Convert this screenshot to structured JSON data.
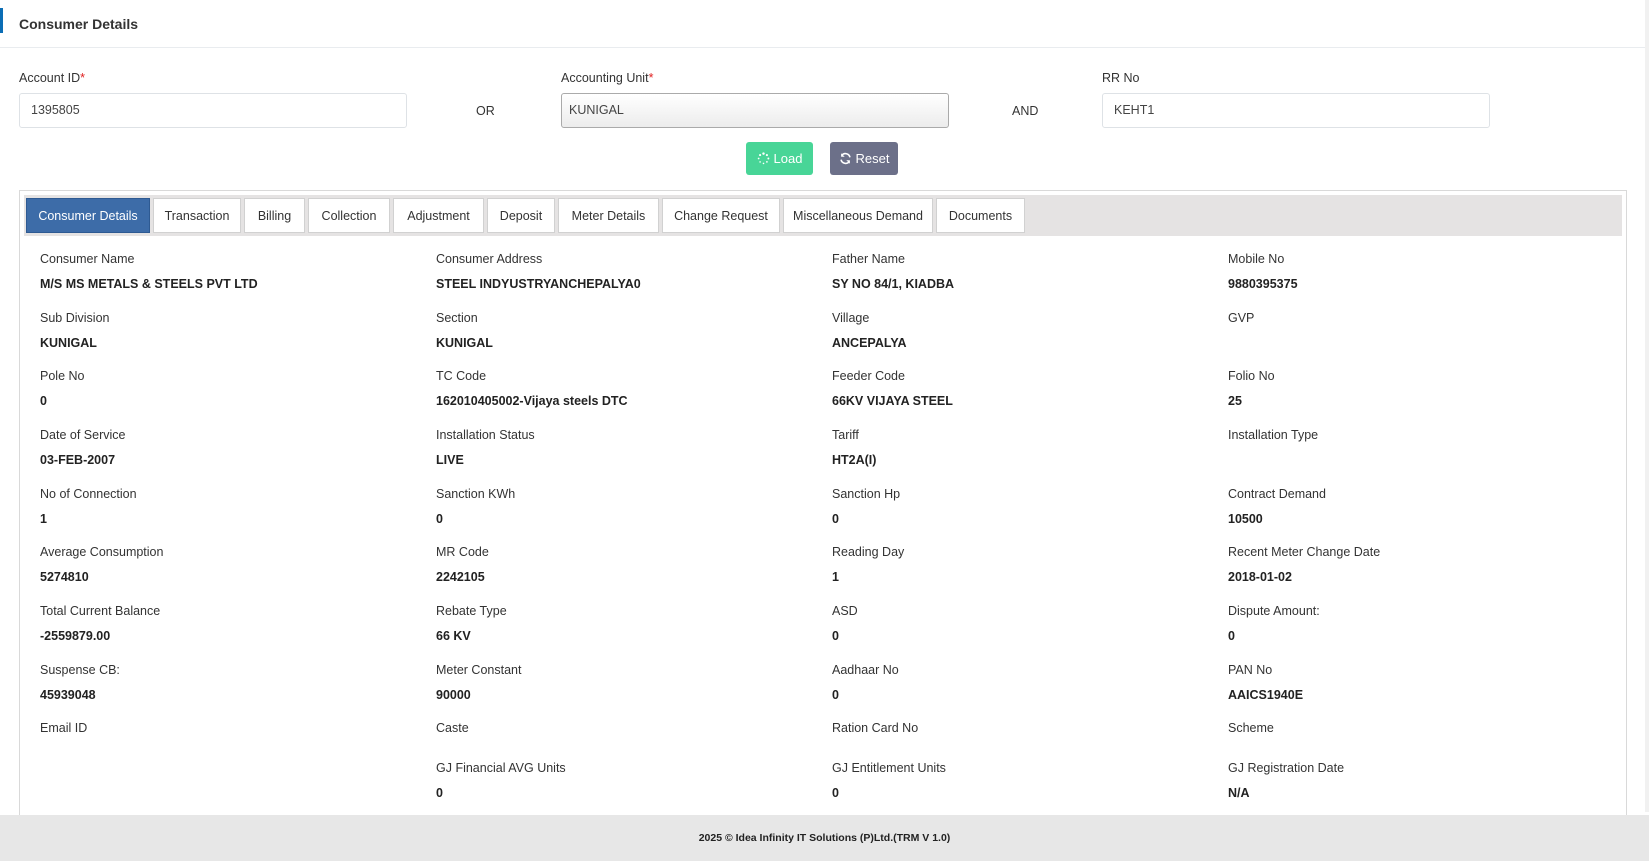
{
  "header": {
    "title": "Consumer Details"
  },
  "form": {
    "account_id": {
      "label": "Account ID",
      "value": "1395805"
    },
    "or_label": "OR",
    "accounting_unit": {
      "label": "Accounting Unit",
      "value": "KUNIGAL"
    },
    "and_label": "AND",
    "rr_no": {
      "label": "RR No",
      "value": "KEHT1"
    },
    "required_mark": "*",
    "load_label": "Load",
    "reset_label": "Reset"
  },
  "tabs": [
    {
      "label": "Consumer Details",
      "active": true
    },
    {
      "label": "Transaction"
    },
    {
      "label": "Billing"
    },
    {
      "label": "Collection"
    },
    {
      "label": "Adjustment"
    },
    {
      "label": "Deposit"
    },
    {
      "label": "Meter Details"
    },
    {
      "label": "Change Request"
    },
    {
      "label": "Miscellaneous Demand"
    },
    {
      "label": "Documents"
    }
  ],
  "details": [
    [
      {
        "label": "Consumer Name",
        "value": "M/S MS METALS & STEELS PVT LTD"
      },
      {
        "label": "Consumer Address",
        "value": "STEEL INDYUSTRYANCHEPALYA0"
      },
      {
        "label": "Father Name",
        "value": "SY NO 84/1, KIADBA"
      },
      {
        "label": "Mobile No",
        "value": "9880395375"
      }
    ],
    [
      {
        "label": "Sub Division",
        "value": "KUNIGAL"
      },
      {
        "label": "Section",
        "value": "KUNIGAL"
      },
      {
        "label": "Village",
        "value": "ANCEPALYA"
      },
      {
        "label": "GVP",
        "value": ""
      }
    ],
    [
      {
        "label": "Pole No",
        "value": "0"
      },
      {
        "label": "TC Code",
        "value": "162010405002-Vijaya steels DTC"
      },
      {
        "label": "Feeder Code",
        "value": "66KV VIJAYA STEEL"
      },
      {
        "label": "Folio No",
        "value": "25"
      }
    ],
    [
      {
        "label": "Date of Service",
        "value": "03-FEB-2007"
      },
      {
        "label": "Installation Status",
        "value": "LIVE"
      },
      {
        "label": "Tariff",
        "value": "HT2A(I)"
      },
      {
        "label": "Installation Type",
        "value": ""
      }
    ],
    [
      {
        "label": "No of Connection",
        "value": "1"
      },
      {
        "label": "Sanction KWh",
        "value": "0"
      },
      {
        "label": "Sanction Hp",
        "value": "0"
      },
      {
        "label": "Contract Demand",
        "value": "10500"
      }
    ],
    [
      {
        "label": "Average Consumption",
        "value": "5274810"
      },
      {
        "label": "MR Code",
        "value": "2242105"
      },
      {
        "label": "Reading Day",
        "value": "1"
      },
      {
        "label": "Recent Meter Change Date",
        "value": "2018-01-02"
      }
    ],
    [
      {
        "label": "Total Current Balance",
        "value": "-2559879.00"
      },
      {
        "label": "Rebate Type",
        "value": "66 KV"
      },
      {
        "label": "ASD",
        "value": "0"
      },
      {
        "label": "Dispute Amount:",
        "value": "0"
      }
    ],
    [
      {
        "label": "Suspense CB:",
        "value": "45939048"
      },
      {
        "label": "Meter Constant",
        "value": "90000"
      },
      {
        "label": "Aadhaar No",
        "value": "0"
      },
      {
        "label": "PAN No",
        "value": "AAICS1940E"
      }
    ],
    [
      {
        "label": "Email ID",
        "value": ""
      },
      {
        "label": "Caste",
        "value": ""
      },
      {
        "label": "Ration Card No",
        "value": ""
      },
      {
        "label": "Scheme",
        "value": ""
      }
    ],
    [
      {
        "label": "",
        "value": ""
      },
      {
        "label": "GJ Financial AVG Units",
        "value": "0"
      },
      {
        "label": "GJ Entitlement Units",
        "value": "0"
      },
      {
        "label": "GJ Registration Date",
        "value": "N/A"
      }
    ]
  ],
  "footer": {
    "text": "2025 © Idea Infinity IT Solutions (P)Ltd.(TRM V 1.0)"
  },
  "colors": {
    "accent": "#0b6db5",
    "load_button": "#48d597",
    "reset_button": "#6c7089",
    "active_tab": "#3d6ca8",
    "required": "#e02020"
  }
}
